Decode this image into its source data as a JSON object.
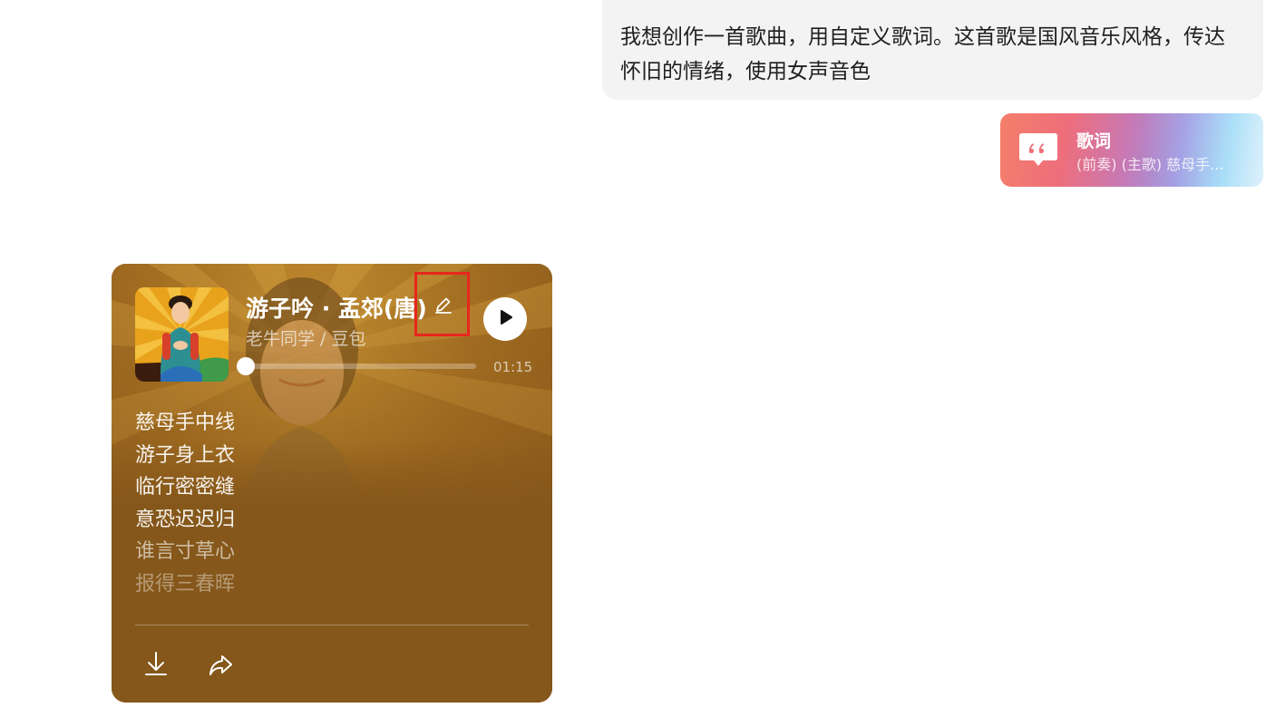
{
  "user_message": {
    "text": "我想创作一首歌曲，用自定义歌词。这首歌是国风音乐风格，传达怀旧的情绪，使用女声音色"
  },
  "lyrics_attachment": {
    "title": "歌词",
    "preview": "(前奏) (主歌) 慈母手...",
    "icon": "quote-icon"
  },
  "song_card": {
    "title": "游子吟 · 孟郊(唐)",
    "artist": "老牛同学 / 豆包",
    "duration": "01:15",
    "progress_fraction": 0.0,
    "lyrics": [
      "慈母手中线",
      "游子身上衣",
      "临行密密缝",
      "意恐迟迟归",
      "谁言寸草心",
      "报得三春晖"
    ],
    "icons": {
      "edit": "pencil-icon",
      "play": "play-icon",
      "download": "download-icon",
      "share": "share-icon"
    },
    "colors": {
      "card_background": "#8a5a1a",
      "highlight_box": "#e8261d"
    }
  }
}
